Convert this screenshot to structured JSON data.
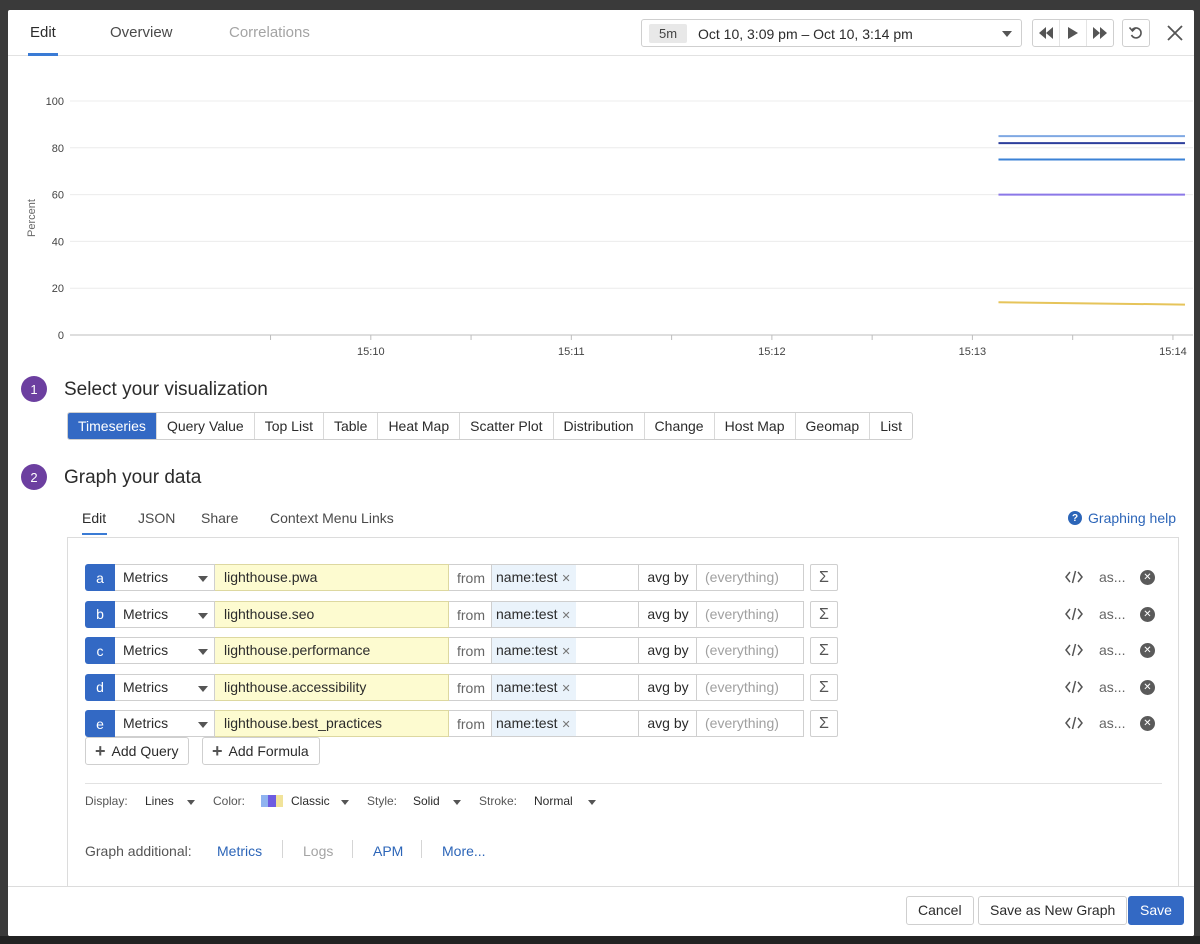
{
  "header": {
    "tabs": [
      {
        "label": "Edit",
        "state": "active"
      },
      {
        "label": "Overview",
        "state": "normal"
      },
      {
        "label": "Correlations",
        "state": "disabled"
      }
    ],
    "time": {
      "span": "5m",
      "range": "Oct 10, 3:09 pm – Oct 10, 3:14 pm"
    }
  },
  "chart_data": {
    "type": "line",
    "ylabel": "Percent",
    "ylim": [
      0,
      100
    ],
    "yticks": [
      "0",
      "20",
      "40",
      "60",
      "80",
      "100"
    ],
    "xticks": [
      {
        "label": "15:10",
        "t": 1
      },
      {
        "label": "15:11",
        "t": 2
      },
      {
        "label": "15:12",
        "t": 3
      },
      {
        "label": "15:13",
        "t": 4
      },
      {
        "label": "15:14",
        "t": 5
      }
    ],
    "xrange": [
      -0.5,
      5.1
    ],
    "series": [
      {
        "color": "#7fa8e3",
        "points": [
          [
            4.13,
            85
          ],
          [
            5.06,
            85
          ]
        ]
      },
      {
        "color": "#2d3f9c",
        "points": [
          [
            4.13,
            82
          ],
          [
            5.06,
            82
          ]
        ]
      },
      {
        "color": "#3b82d6",
        "points": [
          [
            4.13,
            75
          ],
          [
            5.06,
            75
          ]
        ]
      },
      {
        "color": "#8b78e8",
        "points": [
          [
            4.13,
            60
          ],
          [
            5.06,
            60
          ]
        ]
      },
      {
        "color": "#e6c45a",
        "points": [
          [
            4.13,
            14
          ],
          [
            5.06,
            13
          ]
        ]
      }
    ]
  },
  "section1": {
    "step": "1",
    "title": "Select your visualization"
  },
  "viz_types": [
    {
      "label": "Timeseries",
      "active": true
    },
    {
      "label": "Query Value"
    },
    {
      "label": "Top List"
    },
    {
      "label": "Table"
    },
    {
      "label": "Heat Map"
    },
    {
      "label": "Scatter Plot"
    },
    {
      "label": "Distribution"
    },
    {
      "label": "Change"
    },
    {
      "label": "Host Map"
    },
    {
      "label": "Geomap"
    },
    {
      "label": "List"
    }
  ],
  "section2": {
    "step": "2",
    "title": "Graph your data"
  },
  "subtabs": [
    "Edit",
    "JSON",
    "Share",
    "Context Menu Links"
  ],
  "graphing_help": "Graphing help",
  "queries": [
    {
      "letter": "a",
      "source": "Metrics",
      "metric": "lighthouse.pwa",
      "from": "from",
      "tag": "name:test",
      "agg": "avg by",
      "group_placeholder": "(everything)",
      "sigma": "Σ",
      "alias": "as..."
    },
    {
      "letter": "b",
      "source": "Metrics",
      "metric": "lighthouse.seo",
      "from": "from",
      "tag": "name:test",
      "agg": "avg by",
      "group_placeholder": "(everything)",
      "sigma": "Σ",
      "alias": "as..."
    },
    {
      "letter": "c",
      "source": "Metrics",
      "metric": "lighthouse.performance",
      "from": "from",
      "tag": "name:test",
      "agg": "avg by",
      "group_placeholder": "(everything)",
      "sigma": "Σ",
      "alias": "as..."
    },
    {
      "letter": "d",
      "source": "Metrics",
      "metric": "lighthouse.accessibility",
      "from": "from",
      "tag": "name:test",
      "agg": "avg by",
      "group_placeholder": "(everything)",
      "sigma": "Σ",
      "alias": "as..."
    },
    {
      "letter": "e",
      "source": "Metrics",
      "metric": "lighthouse.best_practices",
      "from": "from",
      "tag": "name:test",
      "agg": "avg by",
      "group_placeholder": "(everything)",
      "sigma": "Σ",
      "alias": "as..."
    }
  ],
  "add_query": "Add Query",
  "add_formula": "Add Formula",
  "display_options": {
    "display_label": "Display:",
    "display_value": "Lines",
    "color_label": "Color:",
    "color_value": "Classic",
    "style_label": "Style:",
    "style_value": "Solid",
    "stroke_label": "Stroke:",
    "stroke_value": "Normal",
    "palette": [
      "#8fb3f0",
      "#6d5ce0",
      "#f1e39a"
    ]
  },
  "graph_additional": {
    "label": "Graph additional:",
    "links": [
      {
        "label": "Metrics",
        "enabled": true
      },
      {
        "label": "Logs",
        "enabled": false
      },
      {
        "label": "APM",
        "enabled": true
      },
      {
        "label": "More...",
        "enabled": true
      }
    ]
  },
  "footer": {
    "cancel": "Cancel",
    "save_new": "Save as New Graph",
    "save": "Save"
  },
  "colors": {
    "accent": "#3369c4",
    "step": "#6c3fa0",
    "link": "#2c65b8"
  }
}
